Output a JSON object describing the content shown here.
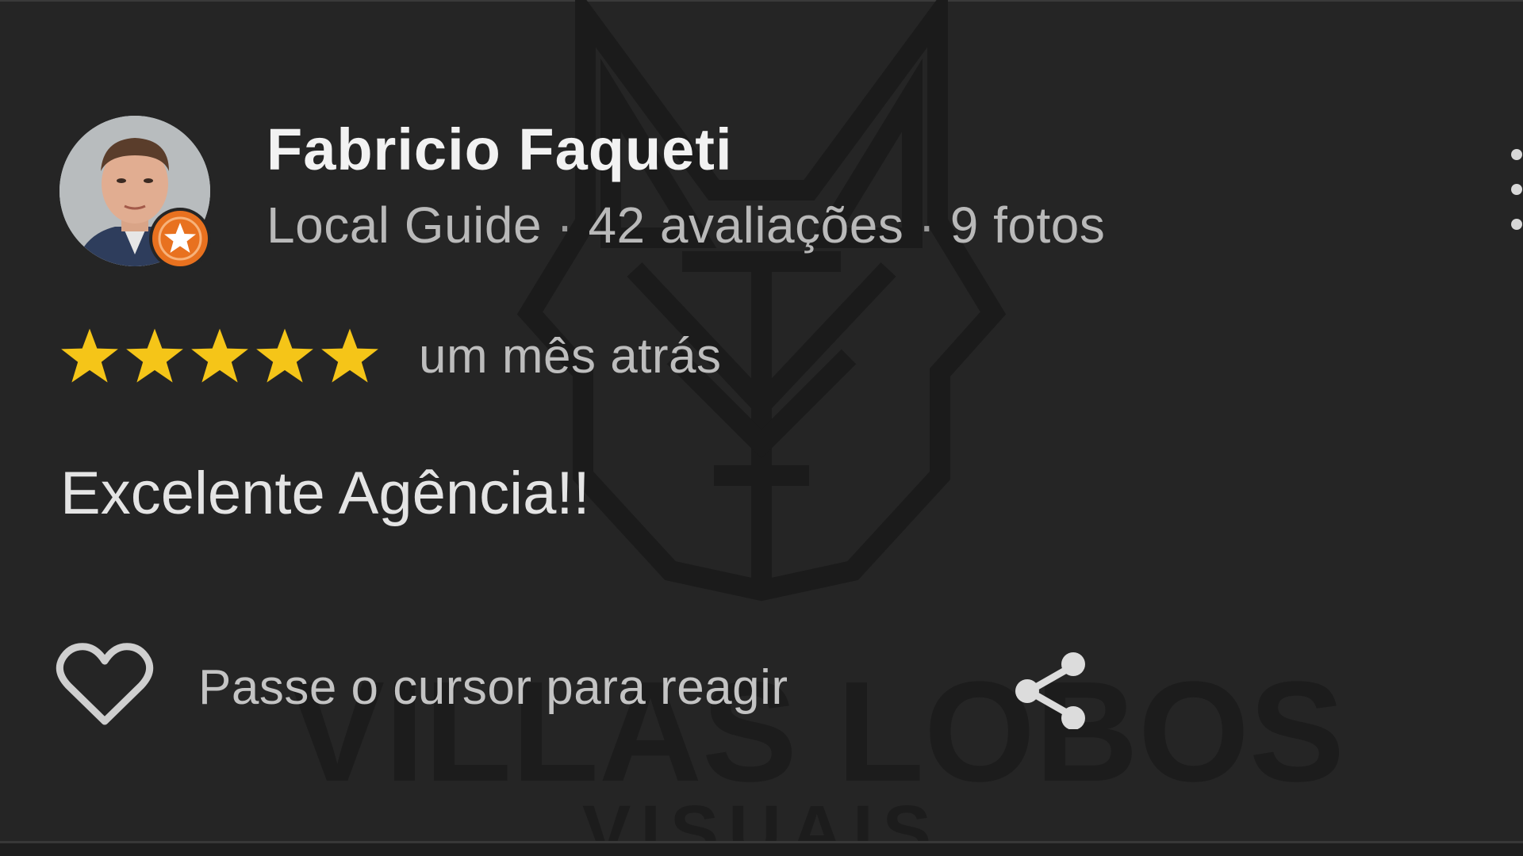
{
  "watermark": {
    "brand": "VILLAS LOBOS",
    "subtitle": "VISUAIS"
  },
  "review": {
    "author": {
      "name": "Fabricio Faqueti",
      "level": "Local Guide",
      "separator": "·",
      "reviews_count": "42 avaliações",
      "photos_count": "9 fotos",
      "badge_icon": "local-guide-star-icon"
    },
    "rating": {
      "stars": 5,
      "max": 5,
      "star_color": "#f5c518"
    },
    "time_ago": "um mês atrás",
    "text": "Excelente Agência!!"
  },
  "actions": {
    "like_icon": "heart-outline-icon",
    "react_hint": "Passe o cursor para reagir",
    "share_icon": "share-icon",
    "more_icon": "more-vertical-icon"
  },
  "colors": {
    "background": "#252525",
    "badge": "#e8711f",
    "star": "#f5c518"
  }
}
